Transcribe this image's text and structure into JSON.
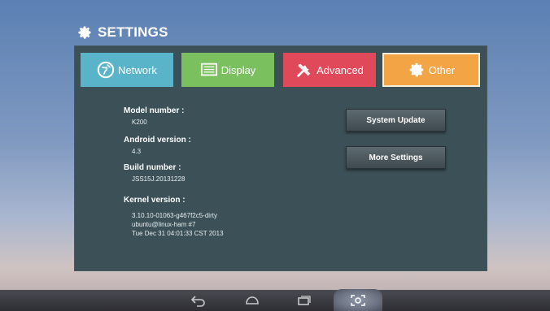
{
  "header": {
    "title": "SETTINGS",
    "icon": "gear-icon"
  },
  "tabs": [
    {
      "label": "Network",
      "icon": "globe-icon",
      "color": "#5ab4c9"
    },
    {
      "label": "Display",
      "icon": "display-icon",
      "color": "#7bc05e"
    },
    {
      "label": "Advanced",
      "icon": "tools-icon",
      "color": "#e0495a"
    },
    {
      "label": "Other",
      "icon": "gear-icon",
      "color": "#f3a545",
      "selected": true
    }
  ],
  "info": {
    "model_label": "Model number :",
    "model_value": "K200",
    "android_label": "Android version :",
    "android_value": "4.3",
    "build_label": "Build number :",
    "build_value": "JSS15J.20131228",
    "kernel_label": "Kernel version :",
    "kernel_line1": "3.10.10-01063-g467f2c5-dirty",
    "kernel_line2": "ubuntu@linux-ham #7",
    "kernel_line3": "Tue Dec 31 04:01:33 CST 2013"
  },
  "buttons": {
    "system_update": "System Update",
    "more_settings": "More Settings"
  },
  "navbar": {
    "icons": [
      "back-icon",
      "home-icon",
      "recent-apps-icon",
      "screenshot-icon"
    ]
  },
  "colors": {
    "panel": "#3b5157",
    "background_top": "#5b80b3",
    "navbar": "#2d2d33"
  }
}
